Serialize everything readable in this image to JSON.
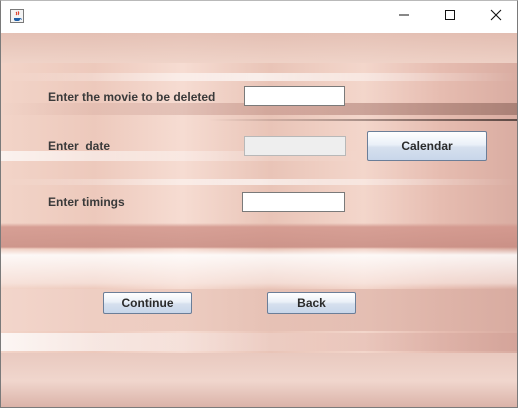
{
  "window": {
    "title": "",
    "icon": "java-cup-icon",
    "controls": {
      "minimize_icon": "minimize-icon",
      "maximize_icon": "maximize-icon",
      "close_icon": "close-icon"
    }
  },
  "form": {
    "movie_label": "Enter the movie to be deleted",
    "movie_value": "",
    "date_label": "Enter  date",
    "date_value": "",
    "calendar_button": "Calendar",
    "timings_label": "Enter timings",
    "timings_value": "",
    "continue_button": "Continue",
    "back_button": "Back"
  },
  "colors": {
    "background_accent": "#e9c4b7",
    "button_border": "#6b7e98",
    "label_text": "#3a3a3a"
  }
}
